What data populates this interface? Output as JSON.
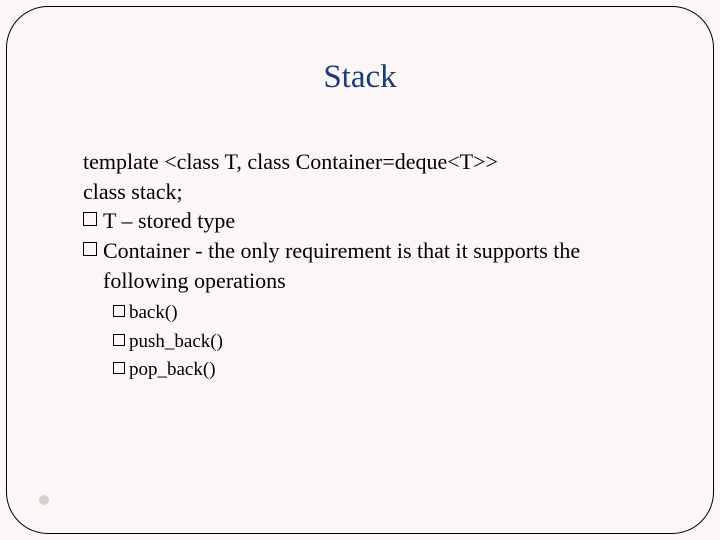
{
  "title": "Stack",
  "code": {
    "line1": "template <class T, class Container=deque<T>>",
    "line2": "class stack;"
  },
  "bullets": {
    "t_param": "T – stored type",
    "container_param": "Container - the only requirement is that it supports the following operations"
  },
  "operations": {
    "back": "back()",
    "push_back": "push_back()",
    "pop_back": "pop_back()"
  }
}
